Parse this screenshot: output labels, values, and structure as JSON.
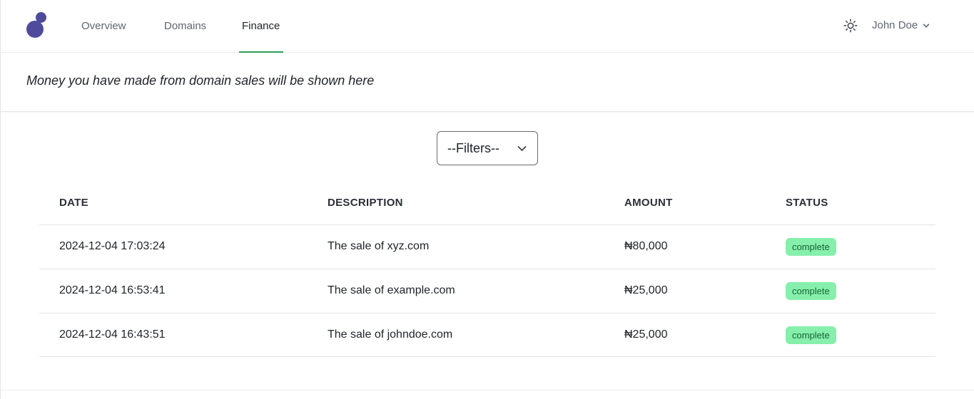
{
  "nav": {
    "tabs": [
      {
        "label": "Overview"
      },
      {
        "label": "Domains"
      },
      {
        "label": "Finance",
        "active": true
      }
    ],
    "user_name": "John Doe",
    "theme_icon": "sun-icon",
    "accent_color": "#2e9e5b",
    "brand_color": "#4f4a9c"
  },
  "banner": {
    "text": "Money you have made from domain sales will be shown here"
  },
  "filters": {
    "selected": "--Filters--"
  },
  "table": {
    "columns": [
      "DATE",
      "DESCRIPTION",
      "AMOUNT",
      "STATUS"
    ],
    "rows": [
      {
        "date": "2024-12-04 17:03:24",
        "description": "The sale of xyz.com",
        "amount": "₦80,000",
        "status": "complete"
      },
      {
        "date": "2024-12-04 16:53:41",
        "description": "The sale of example.com",
        "amount": "₦25,000",
        "status": "complete"
      },
      {
        "date": "2024-12-04 16:43:51",
        "description": "The sale of johndoe.com",
        "amount": "₦25,000",
        "status": "complete"
      }
    ],
    "status_color": "#86efac"
  }
}
